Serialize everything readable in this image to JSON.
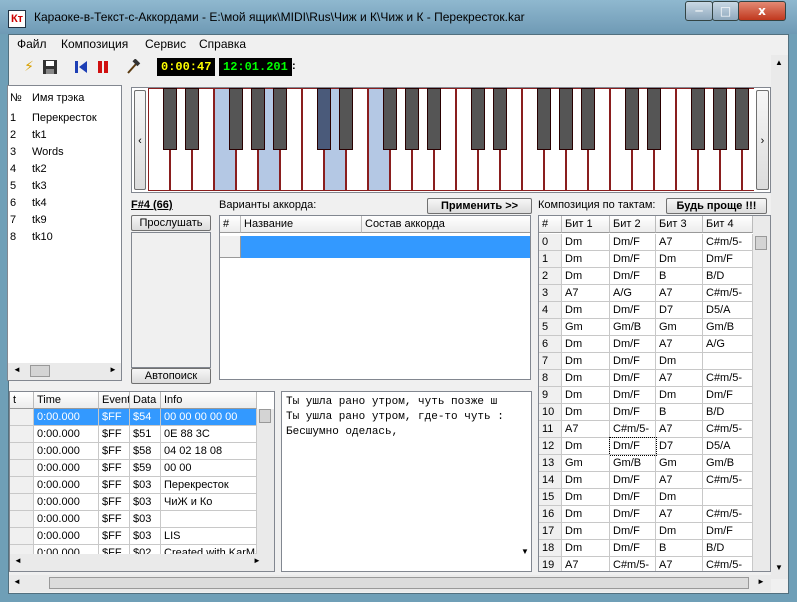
{
  "window": {
    "title": "Караоке-в-Текст-с-Аккордами - E:\\мой ящик\\MIDI\\Rus\\Чиж и К\\Чиж и К - Перекресток.kar",
    "icon_text": "Кт",
    "min": "─",
    "max": "□",
    "close": "x"
  },
  "menu": {
    "items": [
      "Файл",
      "Композиция",
      "Сервис",
      "Справка"
    ]
  },
  "toolbar": {
    "elapsed": "0:00:47",
    "total": "12:01.201",
    "colon": ":"
  },
  "tracks": {
    "headers": [
      "№",
      "Имя трэка"
    ],
    "rows": [
      {
        "num": "1",
        "name": "Перекресток"
      },
      {
        "num": "2",
        "name": "tk1"
      },
      {
        "num": "3",
        "name": "Words"
      },
      {
        "num": "4",
        "name": "tk2"
      },
      {
        "num": "5",
        "name": "tk3"
      },
      {
        "num": "6",
        "name": "tk4"
      },
      {
        "num": "7",
        "name": "tk9"
      },
      {
        "num": "8",
        "name": "tk10"
      }
    ]
  },
  "chord_panel": {
    "note": "F#4 (66)",
    "listen_button": "Прослушать",
    "autosearch_button": "Автопоиск"
  },
  "variants": {
    "label": "Варианты аккорда:",
    "apply_button": "Применить >>",
    "headers": [
      "#",
      "Название",
      "Состав аккорда"
    ]
  },
  "composition": {
    "label": "Композиция по тактам:",
    "simplify_button": "Будь проще !!!",
    "headers": [
      "#",
      "Бит 1",
      "Бит 2",
      "Бит 3",
      "Бит 4"
    ],
    "rows": [
      [
        "0",
        "Dm",
        "Dm/F",
        "A7",
        "C#m/5-"
      ],
      [
        "1",
        "Dm",
        "Dm/F",
        "Dm",
        "Dm/F"
      ],
      [
        "2",
        "Dm",
        "Dm/F",
        "B",
        "B/D"
      ],
      [
        "3",
        "A7",
        "A/G",
        "A7",
        "C#m/5-"
      ],
      [
        "4",
        "Dm",
        "Dm/F",
        "D7",
        "D5/A"
      ],
      [
        "5",
        "Gm",
        "Gm/B",
        "Gm",
        "Gm/B"
      ],
      [
        "6",
        "Dm",
        "Dm/F",
        "A7",
        "A/G"
      ],
      [
        "7",
        "Dm",
        "Dm/F",
        "Dm",
        ""
      ],
      [
        "8",
        "Dm",
        "Dm/F",
        "A7",
        "C#m/5-"
      ],
      [
        "9",
        "Dm",
        "Dm/F",
        "Dm",
        "Dm/F"
      ],
      [
        "10",
        "Dm",
        "Dm/F",
        "B",
        "B/D"
      ],
      [
        "11",
        "A7",
        "C#m/5-",
        "A7",
        "C#m/5-"
      ],
      [
        "12",
        "Dm",
        "Dm/F",
        "D7",
        "D5/A"
      ],
      [
        "13",
        "Gm",
        "Gm/B",
        "Gm",
        "Gm/B"
      ],
      [
        "14",
        "Dm",
        "Dm/F",
        "A7",
        "C#m/5-"
      ],
      [
        "15",
        "Dm",
        "Dm/F",
        "Dm",
        ""
      ],
      [
        "16",
        "Dm",
        "Dm/F",
        "A7",
        "C#m/5-"
      ],
      [
        "17",
        "Dm",
        "Dm/F",
        "Dm",
        "Dm/F"
      ],
      [
        "18",
        "Dm",
        "Dm/F",
        "B",
        "B/D"
      ],
      [
        "19",
        "A7",
        "C#m/5-",
        "A7",
        "C#m/5-"
      ]
    ]
  },
  "events": {
    "headers": [
      "t",
      "Time",
      "Event",
      "Data",
      "Info"
    ],
    "rows": [
      [
        "0:00.000",
        "$FF",
        "$54",
        "00 00 00 00 00"
      ],
      [
        "0:00.000",
        "$FF",
        "$51",
        "0E 88 3C"
      ],
      [
        "0:00.000",
        "$FF",
        "$58",
        "04 02 18 08"
      ],
      [
        "0:00.000",
        "$FF",
        "$59",
        "00 00"
      ],
      [
        "0:00.000",
        "$FF",
        "$03",
        "Перекресток"
      ],
      [
        "0:00.000",
        "$FF",
        "$03",
        "ЧиЖ и Ко"
      ],
      [
        "0:00.000",
        "$FF",
        "$03",
        ""
      ],
      [
        "0:00.000",
        "$FF",
        "$03",
        "LIS"
      ],
      [
        "0:00.000",
        "$FF",
        "$02",
        "Created with KarMa"
      ]
    ]
  },
  "lyrics": {
    "lines": [
      "Ты ушла рано утром, чуть позже ш",
      "Ты ушла рано утром, где-то чуть :",
      "Бесшумно оделась,"
    ]
  },
  "colors": {
    "accent": "#3399ff",
    "time_elapsed": "#ffff00",
    "time_total": "#00ff00",
    "key_border": "#8a1e1e",
    "key_highlight": "#b4c8e4"
  },
  "piano": {
    "highlighted_white_keys": [
      3,
      5,
      8,
      10
    ],
    "highlighted_black_keys": [
      7,
      9
    ]
  },
  "icons": [
    "lightning-icon",
    "save-icon",
    "skip-back-icon",
    "pause-icon",
    "hammer-icon"
  ]
}
